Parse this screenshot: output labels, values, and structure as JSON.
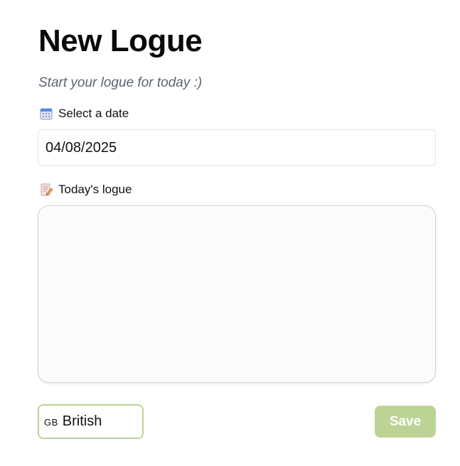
{
  "header": {
    "title": "New Logue",
    "subtitle": "Start your logue for today :)"
  },
  "date_field": {
    "label": "Select a date",
    "icon": "calendar-icon",
    "value": "04/08/2025"
  },
  "logue_field": {
    "label": "Today's logue",
    "icon": "memo-icon",
    "value": ""
  },
  "footer": {
    "language": {
      "flag": "GB",
      "label": "British"
    },
    "save_label": "Save"
  },
  "colors": {
    "accent": "#bcd396",
    "subtitle": "#5b6472"
  }
}
